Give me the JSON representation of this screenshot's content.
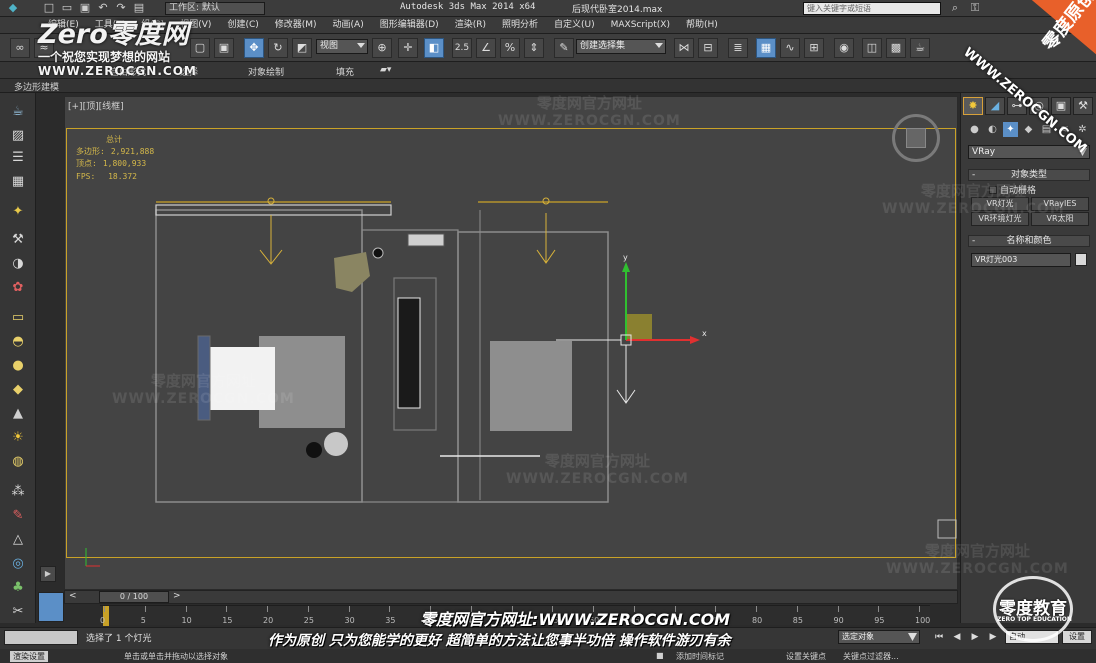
{
  "titlebar": {
    "app_title": "Autodesk 3ds Max  2014 x64",
    "file_title": "后现代卧室2014.max",
    "workspace": "工作区: 默认",
    "search_placeholder": "键入关键字或短语"
  },
  "menu": [
    "编辑(E)",
    "工具(T)",
    "组(G)",
    "视图(V)",
    "创建(C)",
    "修改器(M)",
    "动画(A)",
    "图形编辑器(D)",
    "渲染(R)",
    "照明分析",
    "自定义(U)",
    "MAXScript(X)",
    "帮助(H)"
  ],
  "toolbar": {
    "view_dropdown": "视图",
    "snap_label": "2.5",
    "selection_set": "创建选择集"
  },
  "ribbon": {
    "tab_freeform": "自由形式",
    "tab_selection": "选择",
    "tab_object_paint": "对象绘制",
    "tab_populate": "填充",
    "subtitle": "多边形建模"
  },
  "viewport": {
    "label": "[+][顶][线框]",
    "total_label": "总计",
    "polys_label": "多边形:",
    "polys_value": "2,921,888",
    "verts_label": "顶点:",
    "verts_value": "1,800,933",
    "fps_label": "FPS:",
    "fps_value": "18.372",
    "gizmo_x": "x",
    "gizmo_y": "y"
  },
  "command_panel": {
    "renderer": "VRay",
    "object_type_header": "对象类型",
    "auto_grid": "自动栅格",
    "buttons": [
      "VR灯光",
      "VRayIES",
      "VR环境灯光",
      "VR太阳"
    ],
    "name_color_header": "名称和颜色",
    "object_name": "VR灯光003"
  },
  "timeline": {
    "frame": "0 / 100",
    "ticks": [
      "0",
      "5",
      "10",
      "15",
      "20",
      "25",
      "30",
      "35",
      "40",
      "45",
      "50",
      "55",
      "60",
      "65",
      "70",
      "75",
      "80",
      "85",
      "90",
      "95",
      "100"
    ]
  },
  "status": {
    "selected": "选择了 1 个灯光",
    "hint": "单击或单击并拖动以选择对象",
    "add_time_tag": "添加时间标记",
    "set_key": "设置关键点",
    "key_filters": "关键点过滤器...",
    "selected_dropdown": "选定对象",
    "mini_listener": "渲染设置",
    "key_field": "自动",
    "key_button": "设置"
  },
  "watermarks": {
    "logo_brand": "Zero零度网",
    "logo_slogan": "一个祝您实现梦想的网站",
    "logo_url": "WWW.ZEROCGN.COM",
    "wm_cn": "零度网官方网址",
    "wm_en": "WWW.ZEROCGN.COM",
    "corner_url": "WWW.ZEROCGN.COM",
    "corner_cn": "零度原创",
    "caption_url": "零度网官方网址:WWW.ZEROCGN.COM",
    "caption_msg": "作为原创 只为您能学的更好 超简单的方法让您事半功倍 操作软件游刃有余",
    "edu_cn": "零度教育",
    "edu_en": "ZERO TOP EDUCATION"
  },
  "colors": {
    "viewport_border": "#c9a227",
    "stats_text": "#d4b84a",
    "light_yellow": "#d8b23a",
    "gizmo_x": "#e03030",
    "gizmo_y": "#30c030",
    "active_blue": "#5b8fc7",
    "badge_orange": "#e8602a"
  }
}
